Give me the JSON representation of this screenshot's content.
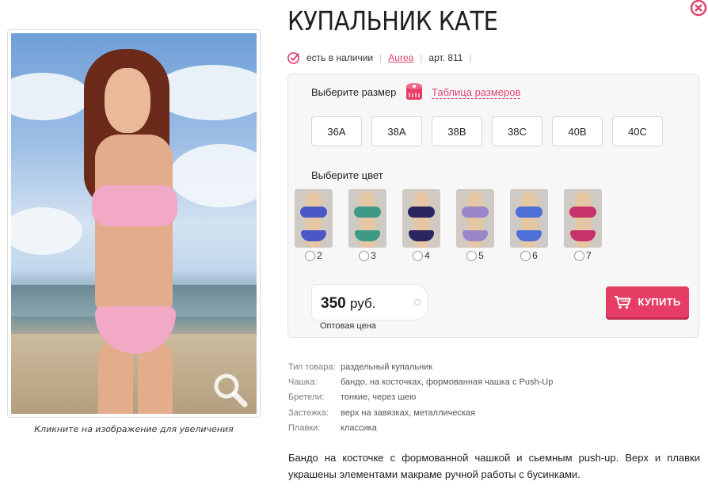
{
  "product": {
    "title": "КУПАЛЬНИК КАТЕ",
    "availability": "есть в наличии",
    "brand": "Aurea",
    "article": "арт. 811"
  },
  "image": {
    "caption": "Кликните на изображение для увеличения"
  },
  "options": {
    "size_label": "Выберите размер",
    "size_chart_link": "Таблица размеров",
    "sizes": [
      "36A",
      "38A",
      "38B",
      "38C",
      "40B",
      "40C"
    ],
    "color_label": "Выберите цвет",
    "colors": [
      {
        "label": "2",
        "swatch": "#4a57c4"
      },
      {
        "label": "3",
        "swatch": "#3e9a86"
      },
      {
        "label": "4",
        "swatch": "#2b2560"
      },
      {
        "label": "5",
        "swatch": "#9a86c8"
      },
      {
        "label": "6",
        "swatch": "#4d6fd6"
      },
      {
        "label": "7",
        "swatch": "#c8326a"
      }
    ]
  },
  "price": {
    "value": "350",
    "currency": "руб.",
    "note": "Оптовая цена"
  },
  "buy_button": {
    "label": "КУПИТЬ",
    "color": "#e63d65"
  },
  "specs": [
    {
      "key": "Тип товара:",
      "value": "раздельный купальник"
    },
    {
      "key": "Чашка:",
      "value": "бандо, на косточках, формованная чашка с Push-Up"
    },
    {
      "key": "Бретели:",
      "value": "тонкие, через шею"
    },
    {
      "key": "Застежка:",
      "value": "верх на завязках, металлическая"
    },
    {
      "key": "Плавки:",
      "value": "классика"
    }
  ],
  "description": "Бандо на косточке с формованной чашкой и сьемным push-up. Верх и плавки украшены элементами макраме ручной работы с бусинками.",
  "accent_color": "#e0456f"
}
